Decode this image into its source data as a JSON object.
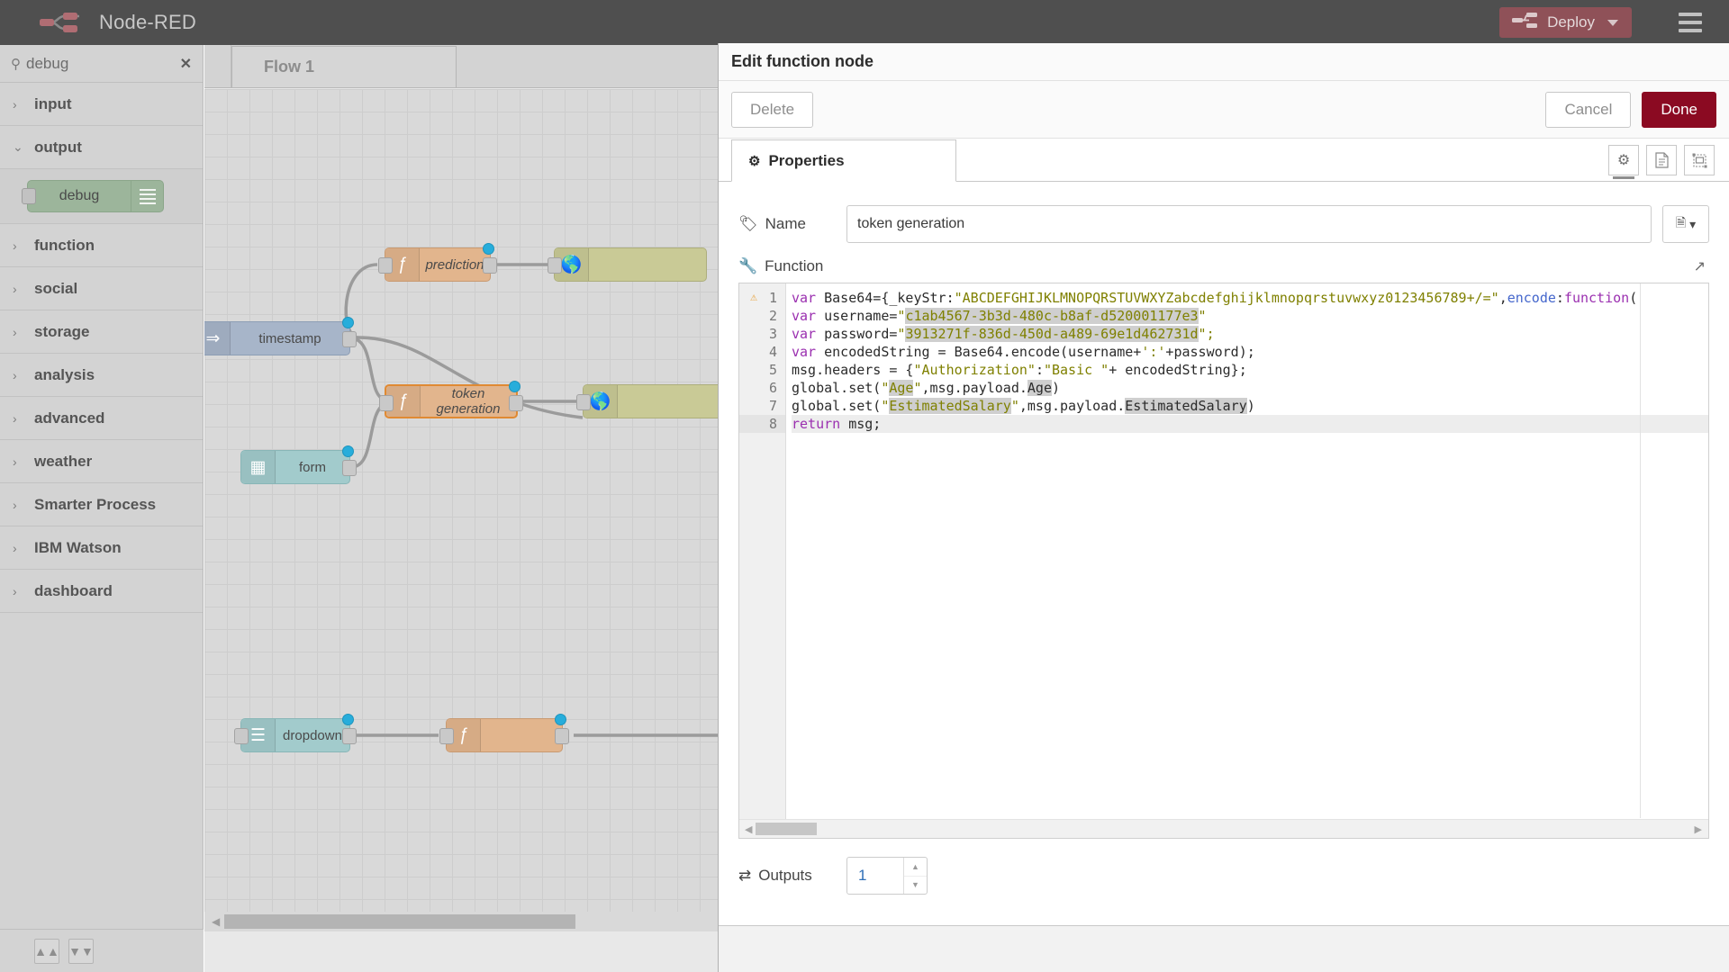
{
  "header": {
    "brand_title": "Node-RED",
    "logo_icon": "node-red-logo-icon",
    "deploy_label": "Deploy",
    "deploy_icon": "deploy-flow-icon",
    "deploy_caret_icon": "chevron-down-icon",
    "menu_icon": "hamburger-menu-icon",
    "deploy_color": "#8f5158",
    "bar_color": "#4f4f4f"
  },
  "palette": {
    "search_value": "debug",
    "search_placeholder": "filter nodes",
    "search_icon": "search-icon",
    "clear_icon": "clear-icon",
    "categories": [
      {
        "label": "input",
        "expanded": false,
        "chevron": "›"
      },
      {
        "label": "output",
        "expanded": true,
        "chevron": "⌄"
      },
      {
        "label": "function",
        "expanded": false,
        "chevron": "›"
      },
      {
        "label": "social",
        "expanded": false,
        "chevron": "›"
      },
      {
        "label": "storage",
        "expanded": false,
        "chevron": "›"
      },
      {
        "label": "analysis",
        "expanded": false,
        "chevron": "›"
      },
      {
        "label": "advanced",
        "expanded": false,
        "chevron": "›"
      },
      {
        "label": "weather",
        "expanded": false,
        "chevron": "›"
      },
      {
        "label": "Smarter Process",
        "expanded": false,
        "chevron": "›"
      },
      {
        "label": "IBM Watson",
        "expanded": false,
        "chevron": "›"
      },
      {
        "label": "dashboard",
        "expanded": false,
        "chevron": "›"
      }
    ],
    "output_nodes": [
      {
        "label": "debug",
        "icon": "debug-lines-icon",
        "color": "#9cb59b"
      }
    ],
    "footer": {
      "collapse_icon": "chevron-double-up-icon",
      "expand_icon": "chevron-double-down-icon"
    }
  },
  "canvas": {
    "tab_label": "Flow 1",
    "scroll_left_icon": "scroll-left-arrow-icon",
    "nodes": [
      {
        "label": "prediction",
        "type": "function",
        "icon": "function-f-icon",
        "selected": false,
        "has_status_dot": true
      },
      {
        "label": "timestamp",
        "type": "inject",
        "icon": "inject-arrow-icon",
        "selected": false,
        "has_status_dot": true
      },
      {
        "label": "token generation",
        "type": "function",
        "icon": "function-f-icon",
        "selected": true,
        "has_status_dot": true
      },
      {
        "label": "form",
        "type": "ui",
        "icon": "ui-form-icon",
        "selected": false,
        "has_status_dot": true
      },
      {
        "label": "dropdown",
        "type": "ui",
        "icon": "ui-dropdown-icon",
        "selected": false,
        "has_status_dot": true
      },
      {
        "label": "",
        "type": "function",
        "icon": "function-f-icon",
        "selected": false,
        "has_status_dot": true
      },
      {
        "label": "",
        "type": "http",
        "icon": "http-globe-icon",
        "selected": false,
        "has_status_dot": false
      },
      {
        "label": "",
        "type": "http",
        "icon": "http-globe-icon",
        "selected": false,
        "has_status_dot": false
      },
      {
        "label": "",
        "type": "http",
        "icon": "http-globe-icon",
        "selected": false,
        "has_status_dot": false
      }
    ]
  },
  "dialog": {
    "title": "Edit function node",
    "delete_label": "Delete",
    "cancel_label": "Cancel",
    "done_label": "Done",
    "done_color": "#8b0a22",
    "tabs": {
      "properties_label": "Properties",
      "properties_icon": "gear-icon",
      "icon_buttons": [
        {
          "name": "gear-icon",
          "glyph": "⚙",
          "active": true
        },
        {
          "name": "description-icon",
          "glyph": "὜E",
          "active": false
        },
        {
          "name": "appearance-icon",
          "glyph": "❐",
          "active": false
        }
      ]
    },
    "name_field": {
      "label": "Name",
      "icon": "tag-icon",
      "value": "token generation",
      "placeholder": "Name",
      "menu_icon": "node-menu-icon",
      "menu_caret_icon": "chevron-down-icon"
    },
    "function_field": {
      "label": "Function",
      "icon": "wrench-icon",
      "expand_icon": "expand-diagonal-icon",
      "warning_icon": "warning-triangle-icon",
      "warning_line": 1,
      "active_line": 8,
      "scroll_left_icon": "scroll-left-arrow-icon",
      "scroll_right_icon": "scroll-right-arrow-icon",
      "lines": [
        {
          "n": "1",
          "tokens": [
            {
              "t": "var ",
              "c": "kw"
            },
            {
              "t": "Base64={_keyStr:",
              "c": "pln"
            },
            {
              "t": "\"ABCDEFGHIJKLMNOPQRSTUVWXYZabcdefghijklmnopqrstuvwxyz0123456789+/=\"",
              "c": "str"
            },
            {
              "t": ",",
              "c": "pln"
            },
            {
              "t": "encode",
              "c": "fn"
            },
            {
              "t": ":",
              "c": "pln"
            },
            {
              "t": "function",
              "c": "kw"
            },
            {
              "t": "(",
              "c": "pln"
            }
          ]
        },
        {
          "n": "2",
          "tokens": [
            {
              "t": "var ",
              "c": "kw"
            },
            {
              "t": "username=",
              "c": "pln"
            },
            {
              "t": "\"",
              "c": "str"
            },
            {
              "t": "c1ab4567-3b3d-480c-b8af-d520001177e3",
              "c": "str hl"
            },
            {
              "t": "\"",
              "c": "str"
            }
          ]
        },
        {
          "n": "3",
          "tokens": [
            {
              "t": "var ",
              "c": "kw"
            },
            {
              "t": "password=",
              "c": "pln"
            },
            {
              "t": "\"",
              "c": "str"
            },
            {
              "t": "3913271f-836d-450d-a489-69e1d462731d",
              "c": "str hl"
            },
            {
              "t": "\";",
              "c": "str"
            }
          ]
        },
        {
          "n": "4",
          "tokens": [
            {
              "t": "var ",
              "c": "kw"
            },
            {
              "t": "encodedString = Base64.encode(username+",
              "c": "pln"
            },
            {
              "t": "':'",
              "c": "str"
            },
            {
              "t": "+password);",
              "c": "pln"
            }
          ]
        },
        {
          "n": "5",
          "tokens": [
            {
              "t": "msg.headers = {",
              "c": "pln"
            },
            {
              "t": "\"Authorization\"",
              "c": "str"
            },
            {
              "t": ":",
              "c": "pln"
            },
            {
              "t": "\"Basic \"",
              "c": "str"
            },
            {
              "t": "+ encodedString};",
              "c": "pln"
            }
          ]
        },
        {
          "n": "6",
          "tokens": [
            {
              "t": "global.set(",
              "c": "pln"
            },
            {
              "t": "\"",
              "c": "str"
            },
            {
              "t": "Age",
              "c": "str hl"
            },
            {
              "t": "\"",
              "c": "str"
            },
            {
              "t": ",msg.payload.",
              "c": "pln"
            },
            {
              "t": "Age",
              "c": "pln hl"
            },
            {
              "t": ")",
              "c": "pln"
            }
          ]
        },
        {
          "n": "7",
          "tokens": [
            {
              "t": "global.set(",
              "c": "pln"
            },
            {
              "t": "\"",
              "c": "str"
            },
            {
              "t": "EstimatedSalary",
              "c": "str hl"
            },
            {
              "t": "\"",
              "c": "str"
            },
            {
              "t": ",msg.payload.",
              "c": "pln"
            },
            {
              "t": "EstimatedSalary",
              "c": "pln hl"
            },
            {
              "t": ")",
              "c": "pln"
            }
          ]
        },
        {
          "n": "8",
          "tokens": [
            {
              "t": "return",
              "c": "kw"
            },
            {
              "t": " msg;",
              "c": "pln"
            }
          ]
        }
      ]
    },
    "outputs_field": {
      "label": "Outputs",
      "icon": "outputs-shuffle-icon",
      "value": "1",
      "up_icon": "stepper-up-icon",
      "down_icon": "stepper-down-icon"
    }
  }
}
